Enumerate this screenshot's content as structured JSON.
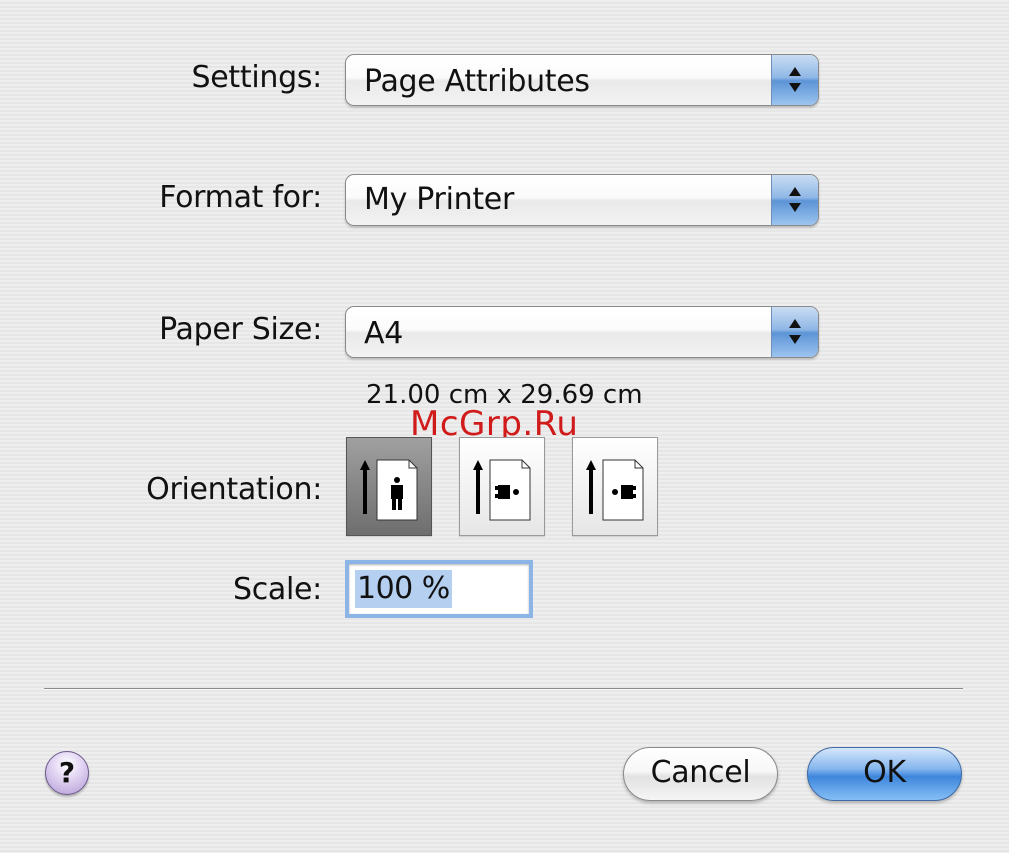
{
  "settings": {
    "label": "Settings:",
    "value": "Page Attributes"
  },
  "format_for": {
    "label": "Format for:",
    "value": "My Printer"
  },
  "paper_size": {
    "label": "Paper Size:",
    "value": "A4",
    "dimensions": "21.00 cm x 29.69 cm"
  },
  "orientation": {
    "label": "Orientation:",
    "options": [
      {
        "name": "portrait",
        "selected": true
      },
      {
        "name": "landscape",
        "selected": false
      },
      {
        "name": "landscape-reversed",
        "selected": false
      }
    ]
  },
  "scale": {
    "label": "Scale:",
    "value": "100 %"
  },
  "buttons": {
    "help": "?",
    "cancel": "Cancel",
    "ok": "OK"
  },
  "watermark": "McGrp.Ru",
  "colors": {
    "accent_blue": "#5d94d6",
    "watermark_red": "#d11a1a",
    "help_purple": "#b49ad6"
  }
}
